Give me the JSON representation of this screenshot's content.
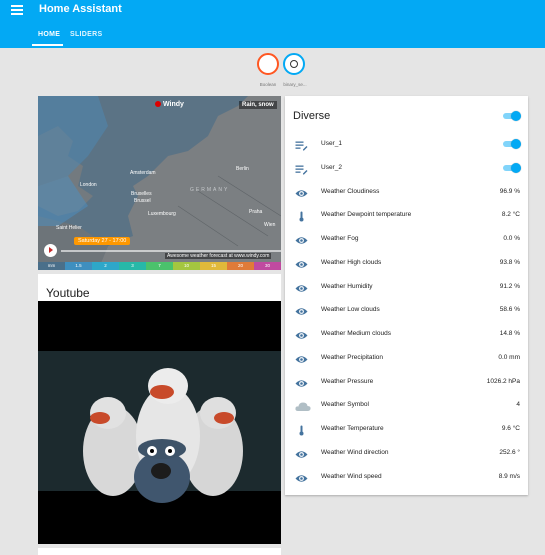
{
  "app": {
    "title": "Home Assistant",
    "tabs": [
      {
        "label": "HOME"
      },
      {
        "label": "SLIDERS"
      }
    ]
  },
  "badges": [
    {
      "label": "Boolean",
      "color": "#ff5722"
    },
    {
      "label": "binary_se...",
      "color": "#03a9f4"
    }
  ],
  "map": {
    "logo": "Windy",
    "layer": "Rain, snow",
    "date": "Saturday 27 - 17:00",
    "forecast_note": "Awesome weather forecast at www.windy.com",
    "country": "GERMANY",
    "cities": [
      "London",
      "Amsterdam",
      "Bruxelles",
      "Brussel",
      "Luxembourg",
      "Saint Helier",
      "Berlin",
      "Praha",
      "Wien"
    ],
    "scale": [
      "mm",
      "1.5",
      "2",
      "3",
      "7",
      "10",
      "15",
      "20",
      "30"
    ]
  },
  "youtube": {
    "title": "Youtube"
  },
  "diverse": {
    "title": "Diverse",
    "rows": [
      {
        "icon": "list-edit-icon",
        "name": "User_1",
        "toggle": true
      },
      {
        "icon": "list-edit-icon",
        "name": "User_2",
        "toggle": true
      },
      {
        "icon": "eye-icon",
        "name": "Weather Cloudiness",
        "value": "96.9 %"
      },
      {
        "icon": "thermometer-icon",
        "name": "Weather Dewpoint temperature",
        "value": "8.2 °C"
      },
      {
        "icon": "eye-icon",
        "name": "Weather Fog",
        "value": "0.0 %"
      },
      {
        "icon": "eye-icon",
        "name": "Weather High clouds",
        "value": "93.8 %"
      },
      {
        "icon": "eye-icon",
        "name": "Weather Humidity",
        "value": "91.2 %"
      },
      {
        "icon": "eye-icon",
        "name": "Weather Low clouds",
        "value": "58.6 %"
      },
      {
        "icon": "eye-icon",
        "name": "Weather Medium clouds",
        "value": "14.8 %"
      },
      {
        "icon": "eye-icon",
        "name": "Weather Precipitation",
        "value": "0.0 mm"
      },
      {
        "icon": "eye-icon",
        "name": "Weather Pressure",
        "value": "1026.2 hPa"
      },
      {
        "icon": "cloud-icon",
        "name": "Weather Symbol",
        "value": "4"
      },
      {
        "icon": "thermometer-icon",
        "name": "Weather Temperature",
        "value": "9.6 °C"
      },
      {
        "icon": "eye-icon",
        "name": "Weather Wind direction",
        "value": "252.6 °"
      },
      {
        "icon": "eye-icon",
        "name": "Weather Wind speed",
        "value": "8.9 m/s"
      }
    ]
  },
  "colors": {
    "primary": "#03a9f4",
    "toggle_track": "#81d4fa",
    "badge_boolean": "#ff5722",
    "icon": "#44739e"
  }
}
